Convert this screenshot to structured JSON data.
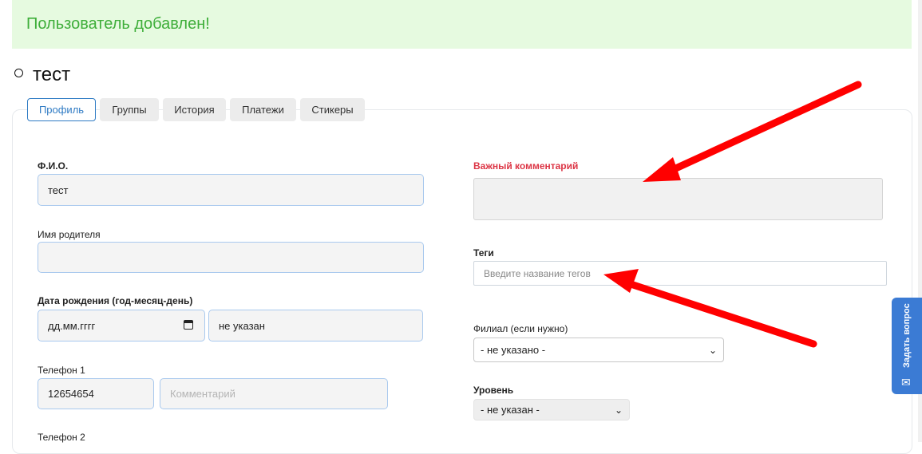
{
  "alert": {
    "message": "Пользователь добавлен!"
  },
  "page_title": "тест",
  "tabs": [
    {
      "label": "Профиль",
      "active": true
    },
    {
      "label": "Группы"
    },
    {
      "label": "История"
    },
    {
      "label": "Платежи"
    },
    {
      "label": "Стикеры"
    }
  ],
  "left": {
    "fio": {
      "label": "Ф.И.О.",
      "value": "тест"
    },
    "parent": {
      "label": "Имя родителя",
      "value": ""
    },
    "birth": {
      "label": "Дата рождения (год-месяц-день)",
      "date_placeholder": "дд.мм.гггг",
      "text_value": "не указан"
    },
    "phone1": {
      "label": "Телефон 1",
      "value": "12654654",
      "comment_placeholder": "Комментарий"
    },
    "phone2": {
      "label": "Телефон 2"
    }
  },
  "right": {
    "important": {
      "label": "Важный комментарий",
      "value": ""
    },
    "tags": {
      "label": "Теги",
      "placeholder": "Введите название тегов"
    },
    "branch": {
      "label": "Филиал (если нужно)",
      "selected": "- не указано -"
    },
    "level": {
      "label": "Уровень",
      "selected": "- не указан -"
    }
  },
  "help_widget": {
    "label": "Задать вопрос",
    "icon": "chat-icon"
  },
  "colors": {
    "accent": "#2f7bc4",
    "alert_bg": "#e6fae0",
    "alert_text": "#3eae3a",
    "danger": "#dc3545",
    "arrow": "#ff0000"
  }
}
